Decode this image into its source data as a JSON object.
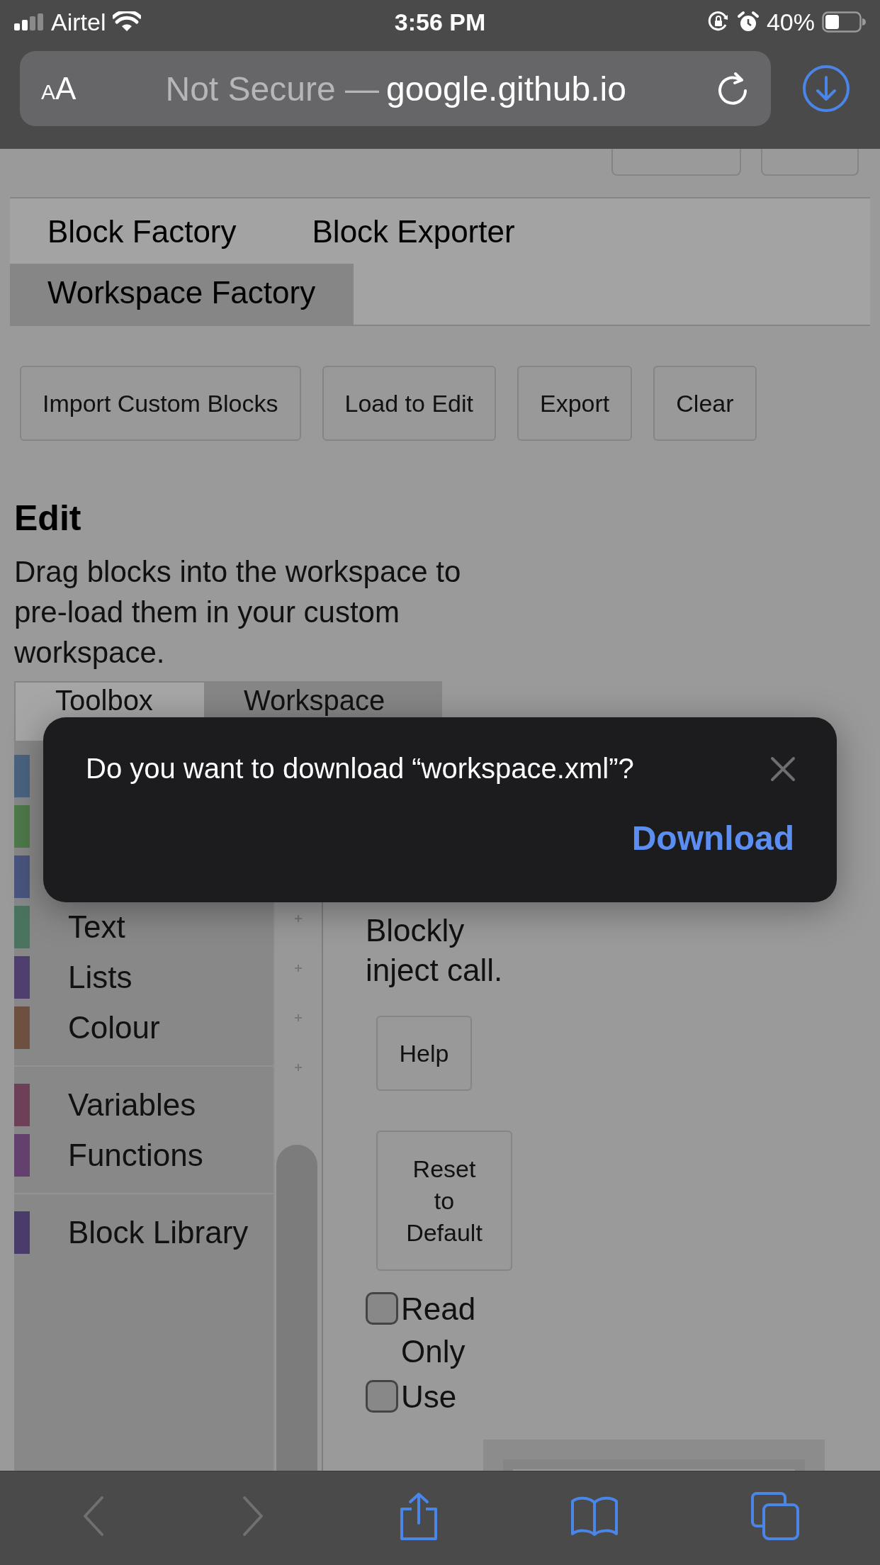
{
  "status_bar": {
    "carrier": "Airtel",
    "time": "3:56 PM",
    "battery": "40%"
  },
  "address_bar": {
    "text_size_button": "AA",
    "security": "Not Secure —",
    "domain": "google.github.io"
  },
  "tabs": [
    {
      "label": "Block Factory",
      "selected": false
    },
    {
      "label": "Block Exporter",
      "selected": false
    },
    {
      "label": "Workspace Factory",
      "selected": true
    }
  ],
  "buttons": [
    "Import Custom Blocks",
    "Load to Edit",
    "Export",
    "Clear"
  ],
  "edit": {
    "heading": "Edit",
    "description": "Drag blocks into the workspace to pre-load them in your custom workspace."
  },
  "editor_tabs": [
    {
      "label": "Toolbox",
      "selected": false
    },
    {
      "label": "Workspace",
      "selected": true
    }
  ],
  "category_groups": [
    {
      "items": [
        {
          "color": "#4a6480"
        },
        {
          "color": "#4f7a4a"
        },
        {
          "color": "#4a5580"
        },
        {
          "label": "Text",
          "color": "#4a7360"
        },
        {
          "label": "Lists",
          "color": "#4e3f6e"
        },
        {
          "label": "Colour",
          "color": "#6e5040"
        }
      ]
    },
    {
      "items": [
        {
          "label": "Variables",
          "color": "#6e4058"
        },
        {
          "label": "Functions",
          "color": "#64406e"
        }
      ]
    },
    {
      "items": [
        {
          "label": "Block Library",
          "color": "#4a3c6a"
        }
      ]
    }
  ],
  "workspace_options": {
    "description_tail": "Blockly inject call.",
    "buttons": [
      "Help",
      "Reset to Default"
    ],
    "checkboxes": [
      {
        "label": "Read Only",
        "checked": false
      },
      {
        "label": "Use",
        "checked": false
      }
    ]
  },
  "dialog": {
    "message": "Do you want to download “workspace.xml”?",
    "action": "Download"
  },
  "toolbar": {
    "back_disabled": true,
    "forward_disabled": true
  }
}
